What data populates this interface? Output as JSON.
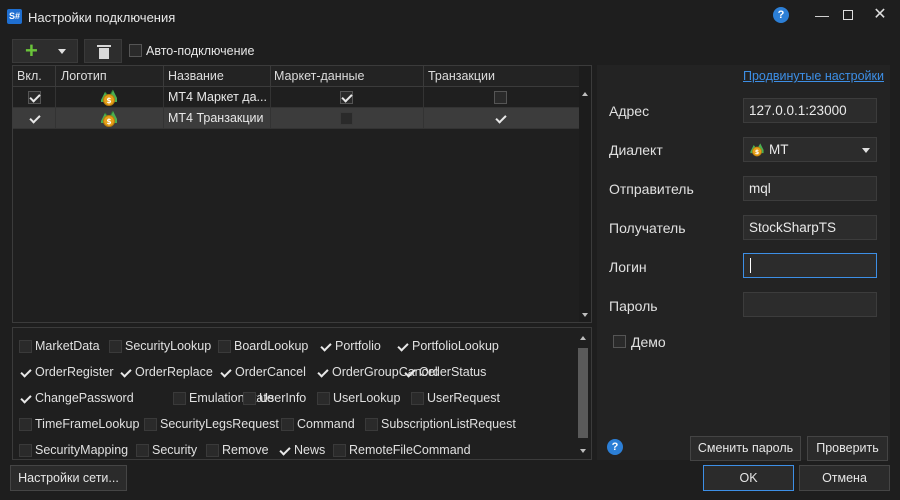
{
  "window": {
    "title": "Настройки подключения",
    "app_logo": "S#"
  },
  "toolbar": {
    "auto_connect_label": "Авто-подключение",
    "auto_connect_checked": false
  },
  "grid": {
    "columns": [
      "Вкл.",
      "Логотип",
      "Название",
      "Маркет-данные",
      "Транзакции"
    ],
    "rows": [
      {
        "enabled": true,
        "logo": "metatrader-coin-icon",
        "name": "MT4 Маркет да...",
        "market_data": true,
        "transactions": false,
        "selected": false
      },
      {
        "enabled": true,
        "logo": "metatrader-coin-icon",
        "name": "MT4 Транзакции",
        "market_data": false,
        "transactions": true,
        "selected": true
      }
    ]
  },
  "capabilities": [
    {
      "label": "MarketData",
      "checked": false
    },
    {
      "label": "SecurityLookup",
      "checked": false
    },
    {
      "label": "BoardLookup",
      "checked": false
    },
    {
      "label": "Portfolio",
      "checked": true
    },
    {
      "label": "PortfolioLookup",
      "checked": true
    },
    {
      "label": "OrderRegister",
      "checked": true
    },
    {
      "label": "OrderReplace",
      "checked": true
    },
    {
      "label": "OrderCancel",
      "checked": true
    },
    {
      "label": "OrderGroupCancel",
      "checked": true
    },
    {
      "label": "OrderStatus",
      "checked": true
    },
    {
      "label": "ChangePassword",
      "checked": true
    },
    {
      "label": "EmulationState",
      "checked": false
    },
    {
      "label": "UserInfo",
      "checked": false
    },
    {
      "label": "UserLookup",
      "checked": false
    },
    {
      "label": "UserRequest",
      "checked": false
    },
    {
      "label": "TimeFrameLookup",
      "checked": false
    },
    {
      "label": "SecurityLegsRequest",
      "checked": false
    },
    {
      "label": "Command",
      "checked": false
    },
    {
      "label": "SubscriptionListRequest",
      "checked": false
    },
    {
      "label": "SecurityMapping",
      "checked": false
    },
    {
      "label": "Security",
      "checked": false
    },
    {
      "label": "Remove",
      "checked": false
    },
    {
      "label": "News",
      "checked": true
    },
    {
      "label": "RemoteFileCommand",
      "checked": false
    }
  ],
  "panel": {
    "advanced_link": "Продвинутые настройки",
    "address_label": "Адрес",
    "address_value": "127.0.0.1:23000",
    "dialect_label": "Диалект",
    "dialect_value": "MT",
    "sender_label": "Отправитель",
    "sender_value": "mql",
    "receiver_label": "Получатель",
    "receiver_value": "StockSharpTS",
    "login_label": "Логин",
    "login_value": "",
    "password_label": "Пароль",
    "password_value": "",
    "demo_label": "Демо",
    "demo_checked": false,
    "change_password_button": "Сменить пароль",
    "check_button": "Проверить"
  },
  "footer": {
    "network_settings_button": "Настройки сети...",
    "ok_button": "OK",
    "cancel_button": "Отмена"
  }
}
